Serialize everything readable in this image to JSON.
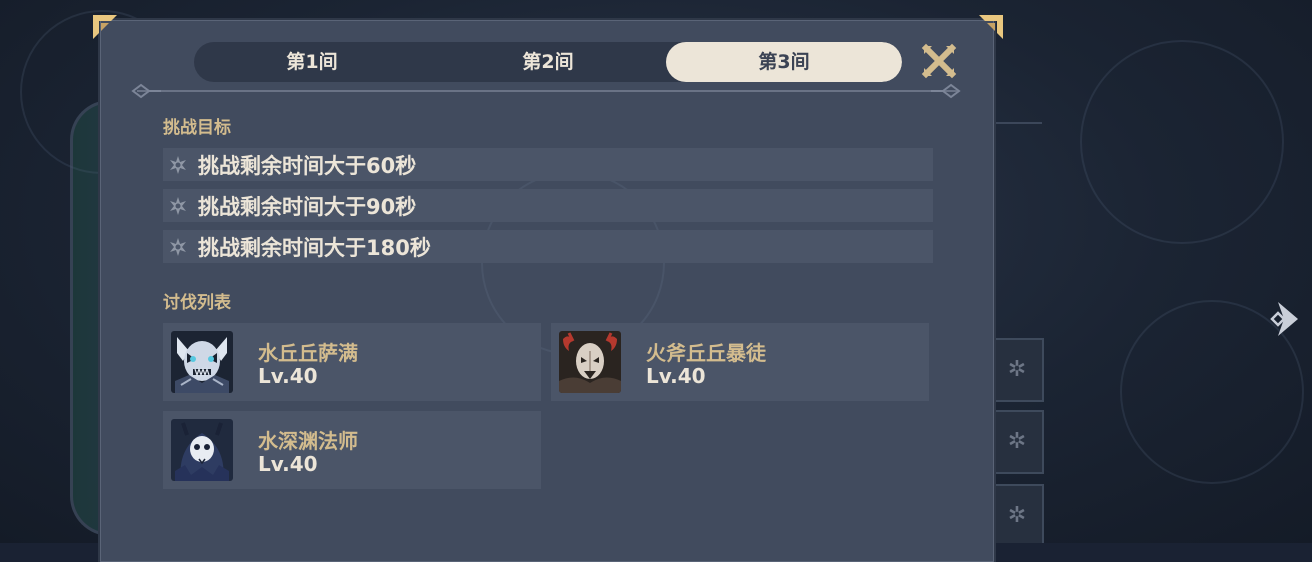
{
  "tabs": [
    {
      "label": "第1间",
      "active": false
    },
    {
      "label": "第2间",
      "active": false
    },
    {
      "label": "第3间",
      "active": true
    }
  ],
  "sections": {
    "goals_title": "挑战目标",
    "enemies_title": "讨伐列表"
  },
  "goals": [
    {
      "text": "挑战剩余时间大于60秒"
    },
    {
      "text": "挑战剩余时间大于90秒"
    },
    {
      "text": "挑战剩余时间大于180秒"
    }
  ],
  "enemies": [
    {
      "name": "水丘丘萨满",
      "level": "Lv.40",
      "icon": "hydro-samachurl-portrait"
    },
    {
      "name": "火斧丘丘暴徒",
      "level": "Lv.40",
      "icon": "pyro-axe-mitachurl-portrait"
    },
    {
      "name": "水深渊法师",
      "level": "Lv.40",
      "icon": "hydro-abyss-mage-portrait"
    }
  ],
  "colors": {
    "panel": "#414b5e",
    "accent_gold": "#d3bc8e",
    "text_light": "#ece5d8",
    "row_bg": "#4b5568"
  }
}
